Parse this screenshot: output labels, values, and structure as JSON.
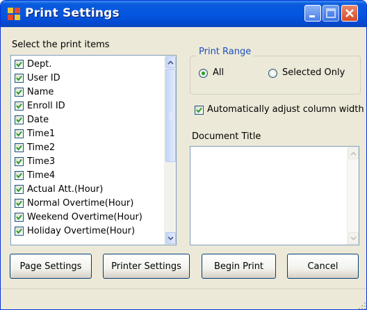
{
  "window": {
    "title": "Print Settings"
  },
  "colors": {
    "titlebar": "#0556e0",
    "group_title": "#1f4fbd",
    "check": "#21a121"
  },
  "items_label": "Select the print items",
  "items": [
    {
      "label": "Dept.",
      "checked": true
    },
    {
      "label": "User ID",
      "checked": true
    },
    {
      "label": "Name",
      "checked": true
    },
    {
      "label": "Enroll ID",
      "checked": true
    },
    {
      "label": "Date",
      "checked": true
    },
    {
      "label": "Time1",
      "checked": true
    },
    {
      "label": "Time2",
      "checked": true
    },
    {
      "label": "Time3",
      "checked": true
    },
    {
      "label": "Time4",
      "checked": true
    },
    {
      "label": "Actual Att.(Hour)",
      "checked": true
    },
    {
      "label": "Normal Overtime(Hour)",
      "checked": true
    },
    {
      "label": "Weekend Overtime(Hour)",
      "checked": true
    },
    {
      "label": "Holiday Overtime(Hour)",
      "checked": true
    }
  ],
  "print_range": {
    "title": "Print Range",
    "options": [
      {
        "label": "All",
        "selected": true
      },
      {
        "label": "Selected Only",
        "selected": false
      }
    ]
  },
  "auto_adjust": {
    "label": "Automatically adjust column width",
    "checked": true
  },
  "document_title": {
    "label": "Document Title",
    "value": ""
  },
  "buttons": {
    "page_settings": "Page Settings",
    "printer_settings": "Printer Settings",
    "begin_print": "Begin Print",
    "cancel": "Cancel"
  }
}
